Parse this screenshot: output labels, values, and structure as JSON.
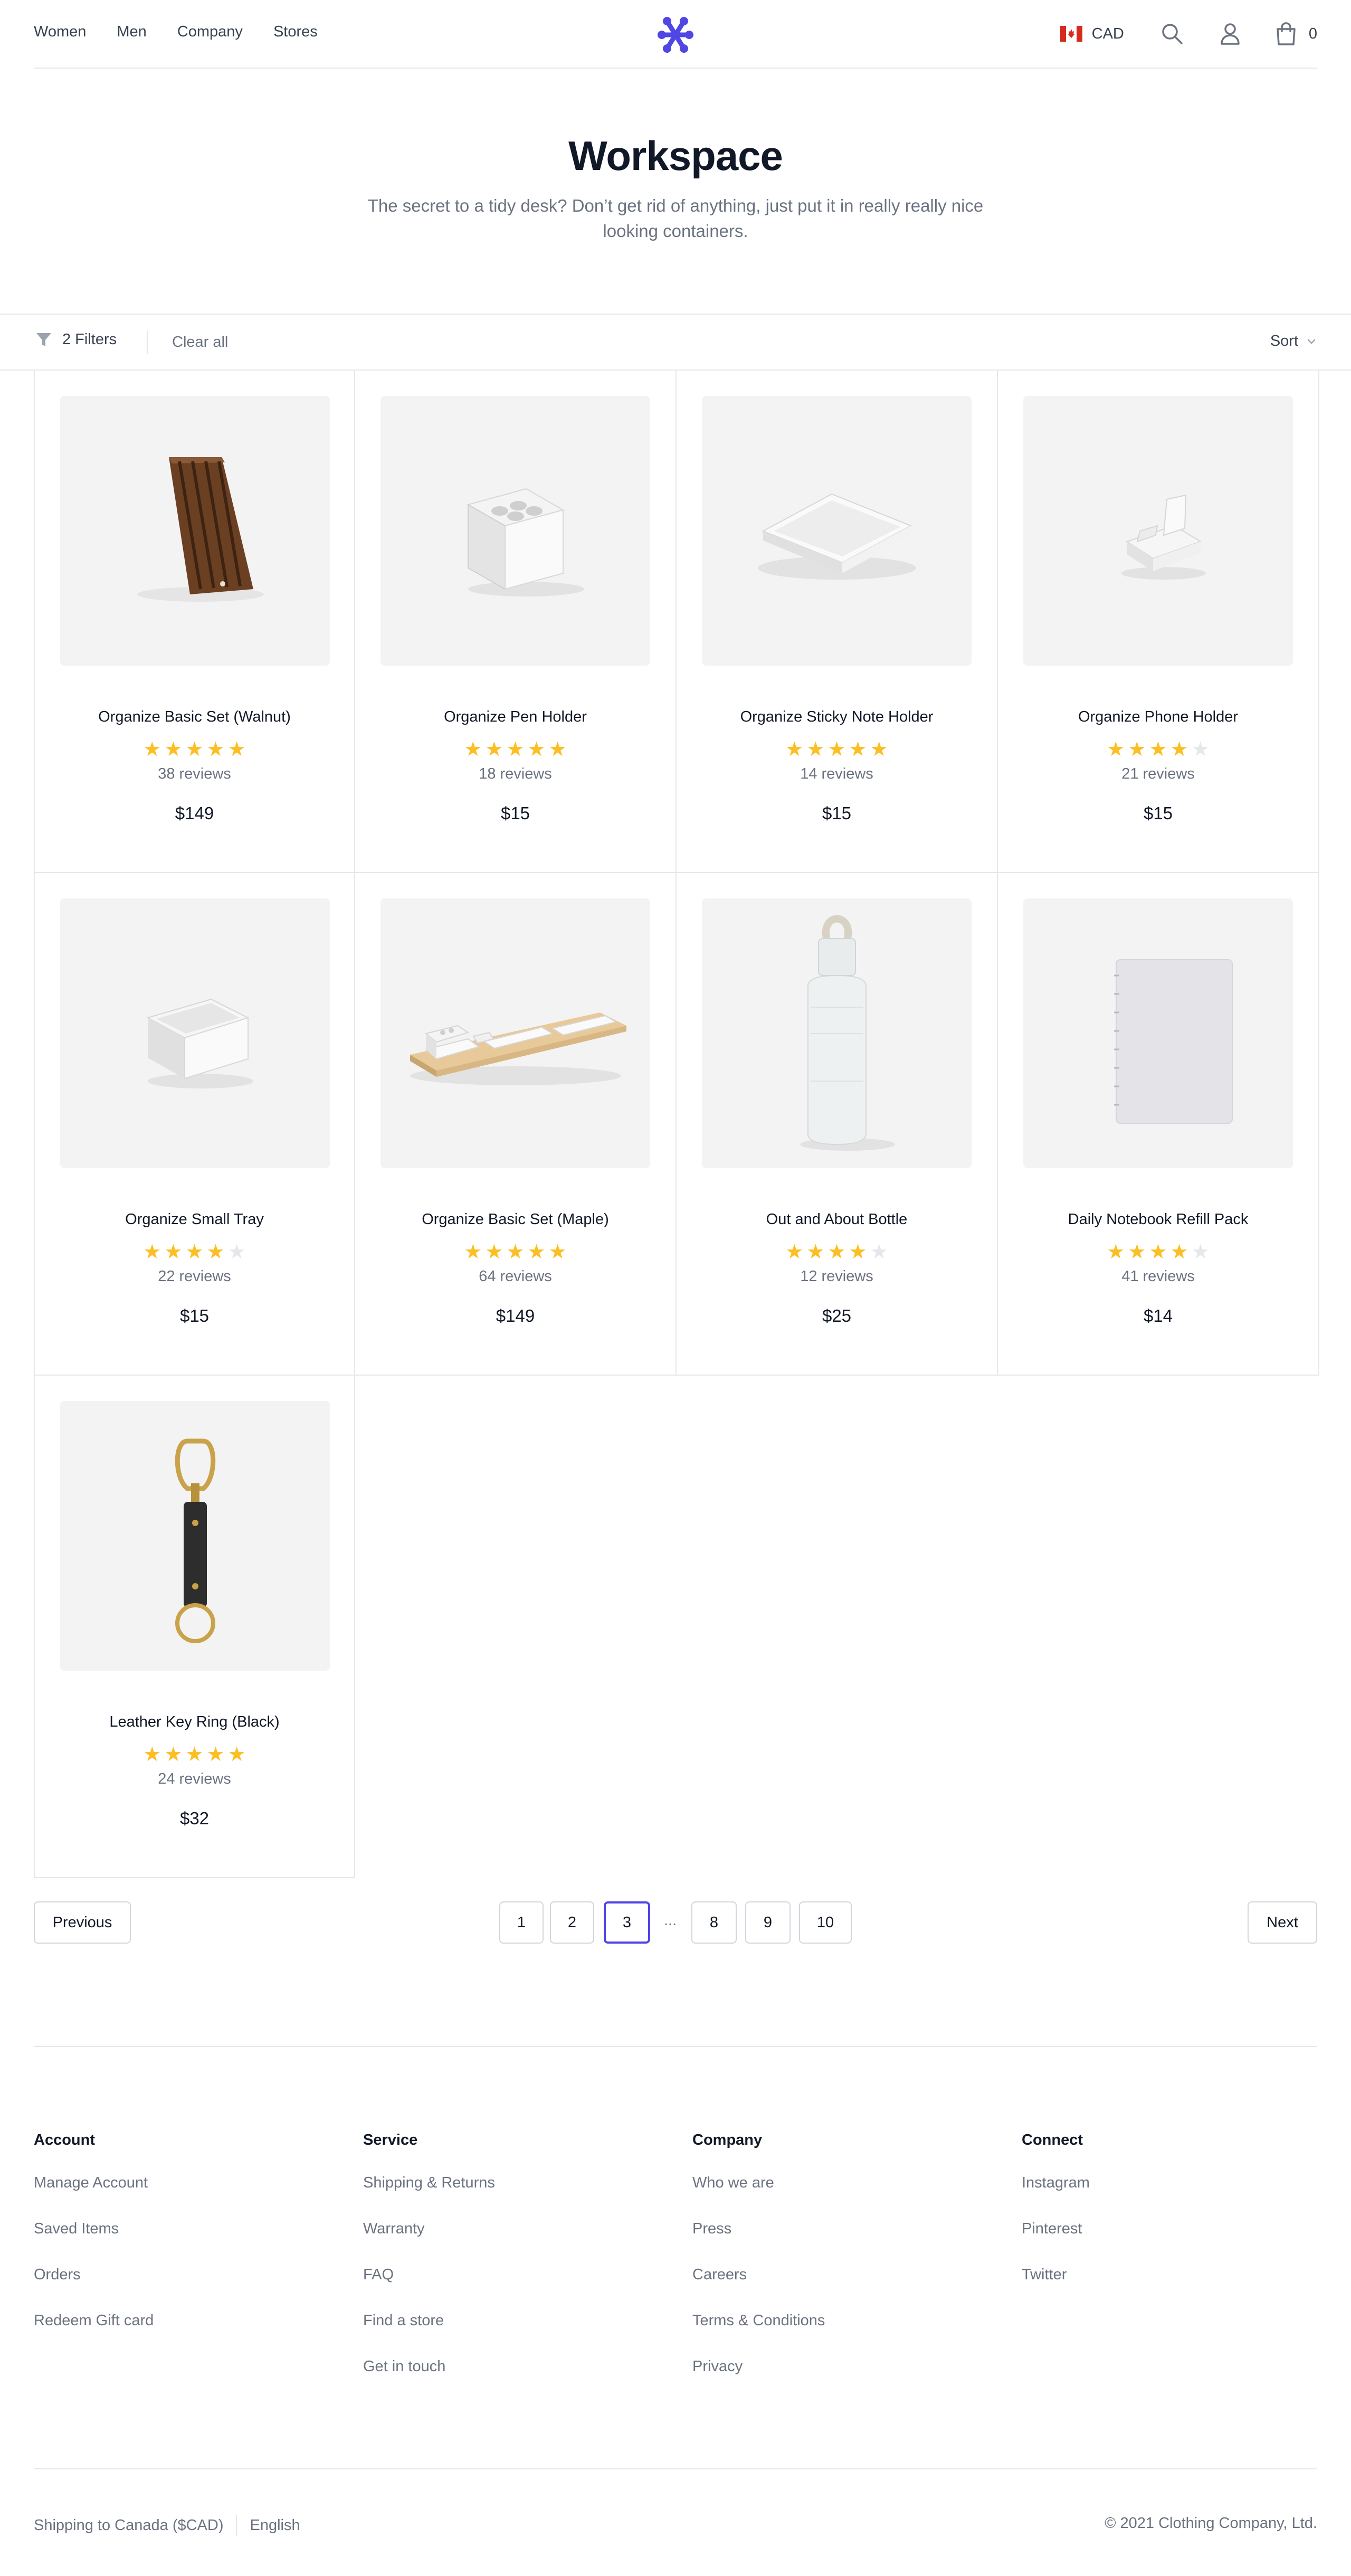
{
  "header": {
    "nav": [
      "Women",
      "Men",
      "Company",
      "Stores"
    ],
    "currency": "CAD",
    "cart_count": "0",
    "accent": "#4f46e5"
  },
  "hero": {
    "title": "Workspace",
    "subtitle": "The secret to a tidy desk? Don’t get rid of anything, just put it in really really nice looking containers."
  },
  "filters": {
    "count_label": "2 Filters",
    "clear_label": "Clear all",
    "sort_label": "Sort"
  },
  "products": [
    {
      "name": "Organize Basic Set (Walnut)",
      "rating": 5,
      "reviews": "38 reviews",
      "price": "$149",
      "image": "walnut-tray"
    },
    {
      "name": "Organize Pen Holder",
      "rating": 5,
      "reviews": "18 reviews",
      "price": "$15",
      "image": "pen-holder"
    },
    {
      "name": "Organize Sticky Note Holder",
      "rating": 5,
      "reviews": "14 reviews",
      "price": "$15",
      "image": "sticky-note-holder"
    },
    {
      "name": "Organize Phone Holder",
      "rating": 4,
      "reviews": "21 reviews",
      "price": "$15",
      "image": "phone-holder"
    },
    {
      "name": "Organize Small Tray",
      "rating": 4,
      "reviews": "22 reviews",
      "price": "$15",
      "image": "small-tray"
    },
    {
      "name": "Organize Basic Set (Maple)",
      "rating": 5,
      "reviews": "64 reviews",
      "price": "$149",
      "image": "maple-set"
    },
    {
      "name": "Out and About Bottle",
      "rating": 4,
      "reviews": "12 reviews",
      "price": "$25",
      "image": "bottle"
    },
    {
      "name": "Daily Notebook Refill Pack",
      "rating": 4,
      "reviews": "41 reviews",
      "price": "$14",
      "image": "notebook"
    },
    {
      "name": "Leather Key Ring (Black)",
      "rating": 5,
      "reviews": "24 reviews",
      "price": "$32",
      "image": "key-ring"
    }
  ],
  "pagination": {
    "previous": "Previous",
    "next": "Next",
    "pages": [
      "1",
      "2",
      "3",
      "8",
      "9",
      "10"
    ],
    "ellipsis": "...",
    "current": "3"
  },
  "footer": {
    "columns": [
      {
        "title": "Account",
        "links": [
          "Manage Account",
          "Saved Items",
          "Orders",
          "Redeem Gift card"
        ]
      },
      {
        "title": "Service",
        "links": [
          "Shipping & Returns",
          "Warranty",
          "FAQ",
          "Find a store",
          "Get in touch"
        ]
      },
      {
        "title": "Company",
        "links": [
          "Who we are",
          "Press",
          "Careers",
          "Terms & Conditions",
          "Privacy"
        ]
      },
      {
        "title": "Connect",
        "links": [
          "Instagram",
          "Pinterest",
          "Twitter"
        ]
      }
    ],
    "shipping": "Shipping to Canada ($CAD)",
    "language": "English",
    "copyright": "© 2021 Clothing Company, Ltd."
  }
}
